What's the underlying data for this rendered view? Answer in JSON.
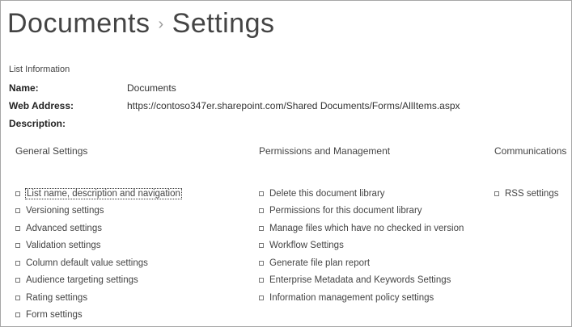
{
  "breadcrumb": {
    "parent": "Documents",
    "separator": "›",
    "current": "Settings"
  },
  "list_information": {
    "heading": "List Information",
    "name_label": "Name:",
    "name_value": "Documents",
    "web_address_label": "Web Address:",
    "web_address_value": "https://contoso347er.sharepoint.com/Shared Documents/Forms/AllItems.aspx",
    "description_label": "Description:"
  },
  "general_settings": {
    "heading": "General Settings",
    "items": [
      "List name, description and navigation",
      "Versioning settings",
      "Advanced settings",
      "Validation settings",
      "Column default value settings",
      "Audience targeting settings",
      "Rating settings",
      "Form settings"
    ]
  },
  "permissions_management": {
    "heading": "Permissions and Management",
    "items": [
      "Delete this document library",
      "Permissions for this document library",
      "Manage files which have no checked in version",
      "Workflow Settings",
      "Generate file plan report",
      "Enterprise Metadata and Keywords Settings",
      "Information management policy settings"
    ]
  },
  "communications": {
    "heading": "Communications",
    "items": [
      "RSS settings"
    ]
  },
  "colors": {
    "text": "#444444",
    "border": "#a6a6a6"
  }
}
